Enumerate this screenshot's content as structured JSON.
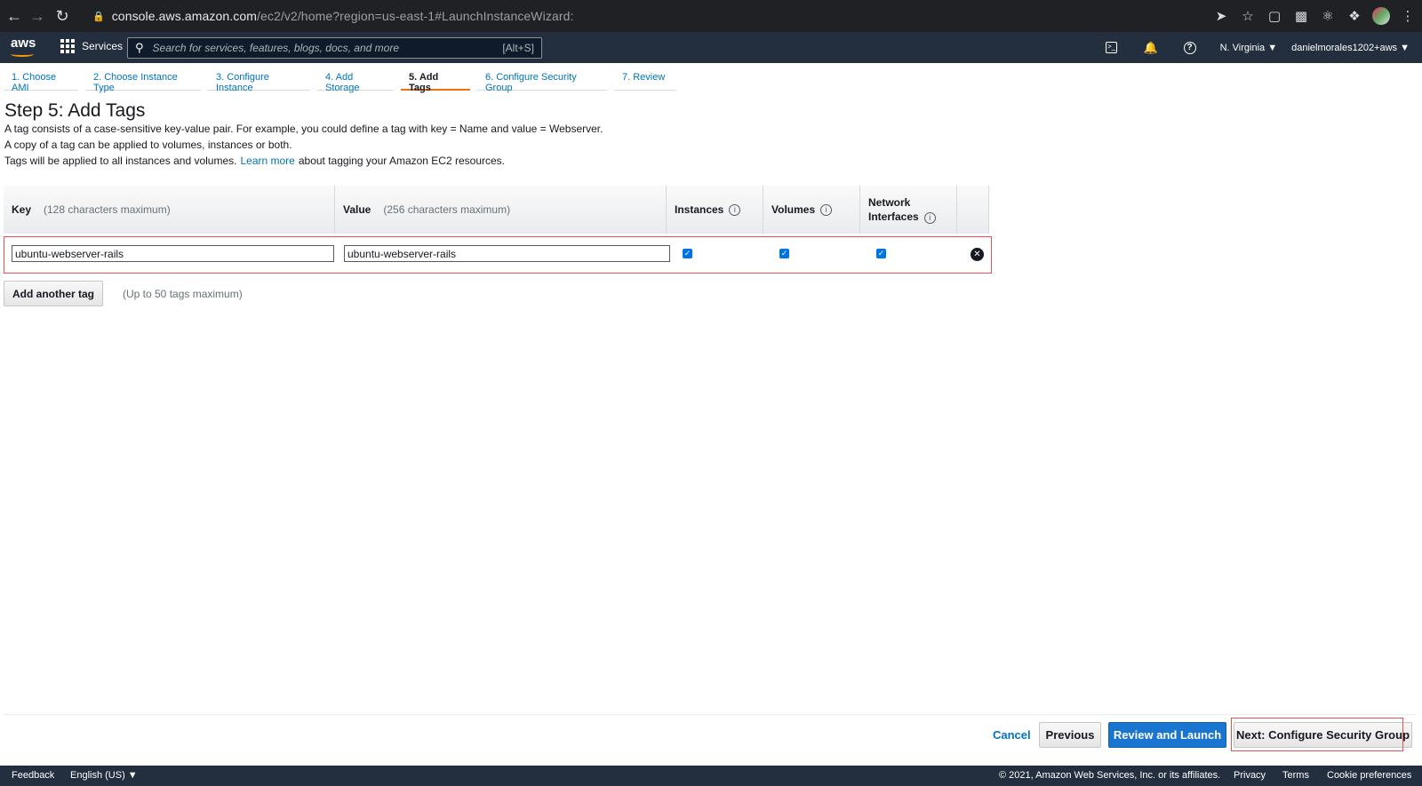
{
  "browser": {
    "url_domain": "console.aws.amazon.com",
    "url_path": "/ec2/v2/home?region=us-east-1#LaunchInstanceWizard:"
  },
  "aws_nav": {
    "logo": "aws",
    "services_label": "Services",
    "search_placeholder": "Search for services, features, blogs, docs, and more",
    "search_shortcut": "[Alt+S]",
    "region": "N. Virginia ▼",
    "account": "danielmorales1202+aws ▼"
  },
  "wizard_tabs": [
    {
      "label": "1. Choose AMI"
    },
    {
      "label": "2. Choose Instance Type"
    },
    {
      "label": "3. Configure Instance"
    },
    {
      "label": "4. Add Storage"
    },
    {
      "label": "5. Add Tags"
    },
    {
      "label": "6. Configure Security Group"
    },
    {
      "label": "7. Review"
    }
  ],
  "page": {
    "title": "Step 5: Add Tags",
    "desc1": "A tag consists of a case-sensitive key-value pair. For example, you could define a tag with key = Name and value = Webserver.",
    "desc2": "A copy of a tag can be applied to volumes, instances or both.",
    "desc3_before": "Tags will be applied to all instances and volumes.",
    "learn_more": "Learn more",
    "desc3_after": "about tagging your Amazon EC2 resources."
  },
  "table": {
    "col_key": "Key",
    "col_key_hint": "(128 characters maximum)",
    "col_value": "Value",
    "col_value_hint": "(256 characters maximum)",
    "col_instances": "Instances",
    "col_volumes": "Volumes",
    "col_network_1": "Network",
    "col_network_2": "Interfaces",
    "row": {
      "key": "ubuntu-webserver-rails",
      "value": "ubuntu-webserver-rails",
      "instances_checked": true,
      "volumes_checked": true,
      "network_checked": true
    }
  },
  "add_tag_label": "Add another tag",
  "max_tags_hint": "(Up to 50 tags maximum)",
  "actions": {
    "cancel": "Cancel",
    "previous": "Previous",
    "review": "Review and Launch",
    "next": "Next: Configure Security Group"
  },
  "footer": {
    "feedback": "Feedback",
    "language": "English (US) ▼",
    "copyright": "© 2021, Amazon Web Services, Inc. or its affiliates.",
    "privacy": "Privacy",
    "terms": "Terms",
    "cookies": "Cookie preferences"
  }
}
